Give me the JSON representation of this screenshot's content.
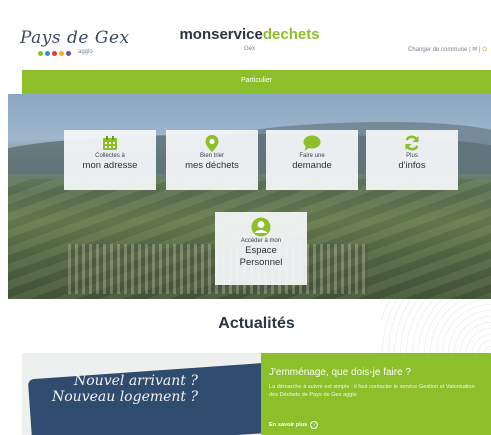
{
  "header": {
    "logo": {
      "text": "Pays de Gex",
      "sub": "agglo"
    },
    "brand": {
      "part1": "monservice",
      "part2": "dechets"
    },
    "commune": "Gex",
    "change_commune": "Changer de commune",
    "mail_icon": "mail-icon",
    "brand_color": "#8cbf2a"
  },
  "nav": {
    "tab": "Particulier"
  },
  "tiles": {
    "collectes": {
      "line1": "Collectes à",
      "line2": "mon adresse",
      "icon": "calendar-icon"
    },
    "trier": {
      "line1": "Bien trier",
      "line2": "mes déchets",
      "icon": "location-pin-icon"
    },
    "demande": {
      "line1": "Faire une",
      "line2": "demande",
      "icon": "chat-bubble-icon"
    },
    "plus": {
      "line1": "Plus",
      "line2": "d'infos",
      "icon": "refresh-icon"
    },
    "espace": {
      "line1": "Accéder à mon",
      "line2": "Espace",
      "line3": "Personnel",
      "icon": "user-icon"
    }
  },
  "news": {
    "title": "Actualités",
    "image_text": {
      "line1": "Nouvel arrivant ?",
      "line2": "Nouveau logement ?"
    },
    "card": {
      "heading": "J'emménage, que dois-je faire ?",
      "body": "La démarche à suivre est simple : il faut contacter le service Gestion et Valorisation des Déchets de Pays de Gex agglo",
      "more": "En savoir plus"
    }
  }
}
